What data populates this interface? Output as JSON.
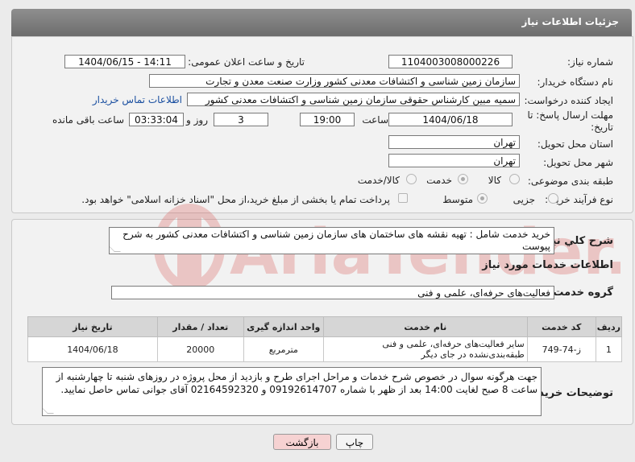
{
  "header": {
    "title": "جزئیات اطلاعات نیاز"
  },
  "labels": {
    "need_number": "شماره نیاز:",
    "announce_datetime": "تاریخ و ساعت اعلان عمومی:",
    "buyer_org": "نام دستگاه خریدار:",
    "requester": "ایجاد کننده درخواست:",
    "reply_deadline_1": "مهلت ارسال پاسخ: تا",
    "reply_deadline_2": "تاریخ:",
    "time_word": "ساعت",
    "days_and": "روز و",
    "hours_remaining": "ساعت باقی مانده",
    "delivery_province": "استان محل تحویل:",
    "delivery_city": "شهر محل تحویل:",
    "category": "طبقه بندی موضوعی:",
    "purchase_type": "نوع فرآیند خرید :",
    "general_desc": "شرح کلي نياز:",
    "services_info": "اطلاعات خدمات مورد نیاز",
    "service_group": "گروه خدمت:",
    "buyer_notes": "توضیحات خریدار:"
  },
  "fields": {
    "need_number": "1104003008000226",
    "announce_datetime": "1404/06/15 - 14:11",
    "buyer_org": "سازمان زمین شناسی و اکتشافات معدنی کشور وزارت صنعت معدن و تجارت",
    "requester": "سمیه مبین کارشناس حقوقی سازمان زمین شناسی و اکتشافات معدنی کشور",
    "contact_link": "اطلاعات تماس خریدار",
    "deadline_date": "1404/06/18",
    "deadline_time": "19:00",
    "days": "3",
    "remaining": "03:33:04",
    "province": "تهران",
    "city": "تهران",
    "general_desc": "خرید خدمت شامل : تهیه نقشه های ساختمان های سازمان زمین شناسی و اکتشافات معدنی کشور به شرح پیوست",
    "service_group": "فعالیت‌های حرفه‌ای، علمی و فنی",
    "buyer_notes": "جهت هرگونه سوال در خصوص شرح خدمات و مراحل اجرای طرح و بازدید از محل پروژه در روزهای شنبه تا چهارشنبه از ساعت 8 صبح لغایت 14:00 بعد از ظهر با شماره 09192614707 و 02164592320 آقای جوانی تماس حاصل نمایید."
  },
  "category_options": [
    {
      "label": "کالا",
      "selected": false
    },
    {
      "label": "خدمت",
      "selected": true
    },
    {
      "label": "کالا/خدمت",
      "selected": false
    }
  ],
  "purchase_options": [
    {
      "label": "جزیی",
      "selected": false
    },
    {
      "label": "متوسط",
      "selected": true
    }
  ],
  "treasury_note": "پرداخت تمام یا بخشی از مبلغ خرید،از محل \"اسناد خزانه اسلامی\" خواهد بود.",
  "table": {
    "headers": [
      "ردیف",
      "کد خدمت",
      "نام خدمت",
      "واحد اندازه گیری",
      "تعداد / مقدار",
      "تاریخ نیاز"
    ],
    "rows": [
      [
        "1",
        "ز-74-749",
        "سایر فعالیت‌های حرفه‌ای، علمی و فنی طبقه‌بندی‌نشده در جای دیگر",
        "مترمربع",
        "20000",
        "1404/06/18"
      ]
    ]
  },
  "buttons": {
    "print": "چاپ",
    "back": "بازگشت"
  },
  "watermark": {
    "text": "AriaTender.net"
  },
  "colors": {
    "header": "#7a7a7a",
    "link": "#1a4fa0",
    "back_button": "#f6d2d2",
    "watermark": "#d9534f"
  }
}
